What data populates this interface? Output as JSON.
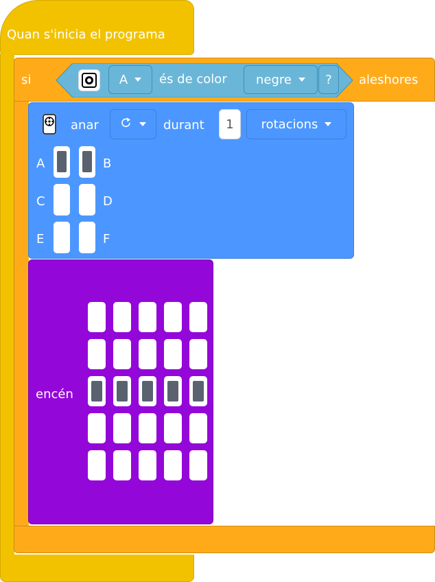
{
  "event": {
    "label": "Quan s'inicia el programa"
  },
  "if_block": {
    "if_label": "si",
    "then_label": "aleshores",
    "condition": {
      "sensor_icon": "color-sensor-icon",
      "port": "A",
      "text": "és de color",
      "color": "negre",
      "question": "?"
    }
  },
  "motor_block": {
    "icon": "motor-pair-icon",
    "action": "anar",
    "direction_icon": "clockwise-icon",
    "duration_label": "durant",
    "amount": "1",
    "unit": "rotacions",
    "ports": [
      {
        "left": "A",
        "right": "B",
        "left_on": true,
        "right_on": true
      },
      {
        "left": "C",
        "right": "D",
        "left_on": false,
        "right_on": false
      },
      {
        "left": "E",
        "right": "F",
        "left_on": false,
        "right_on": false
      }
    ]
  },
  "matrix_block": {
    "label": "encén",
    "pixels": [
      [
        0,
        0,
        0,
        0,
        0
      ],
      [
        0,
        0,
        0,
        0,
        0
      ],
      [
        1,
        1,
        1,
        1,
        1
      ],
      [
        0,
        0,
        0,
        0,
        0
      ],
      [
        0,
        0,
        0,
        0,
        0
      ]
    ]
  },
  "colors": {
    "event": "#f2c200",
    "control": "#ffab19",
    "sensor": "#6ab6d8",
    "motor": "#4c97ff",
    "matrix": "#9407d9"
  }
}
